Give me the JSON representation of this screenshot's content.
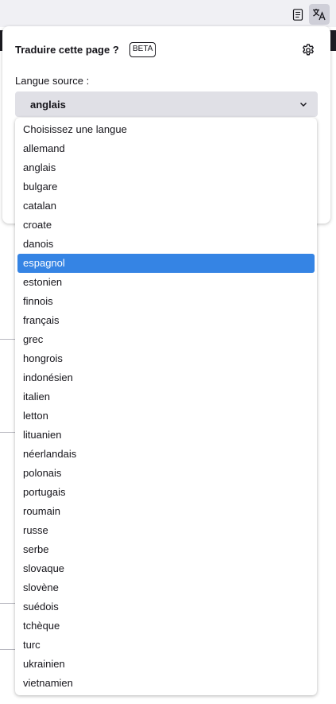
{
  "toolbar": {
    "reader_icon": "reader-view-icon",
    "translate_icon": "translate-icon"
  },
  "panel": {
    "title": "Traduire cette page ?",
    "badge": "BETA",
    "settings_icon": "gear-icon",
    "source_label": "Langue source :",
    "source_value": "anglais",
    "chevron_icon": "chevron-down-icon"
  },
  "dropdown": {
    "highlighted_index": 7,
    "options": [
      "Choisissez une langue",
      "allemand",
      "anglais",
      "bulgare",
      "catalan",
      "croate",
      "danois",
      "espagnol",
      "estonien",
      "finnois",
      "français",
      "grec",
      "hongrois",
      "indonésien",
      "italien",
      "letton",
      "lituanien",
      "néerlandais",
      "polonais",
      "portugais",
      "roumain",
      "russe",
      "serbe",
      "slovaque",
      "slovène",
      "suédois",
      "tchèque",
      "turc",
      "ukrainien",
      "vietnamien"
    ]
  },
  "colors": {
    "highlight": "#3584e4",
    "toolbar": "#f0f0f4",
    "select_bg": "#e0e0e6"
  }
}
